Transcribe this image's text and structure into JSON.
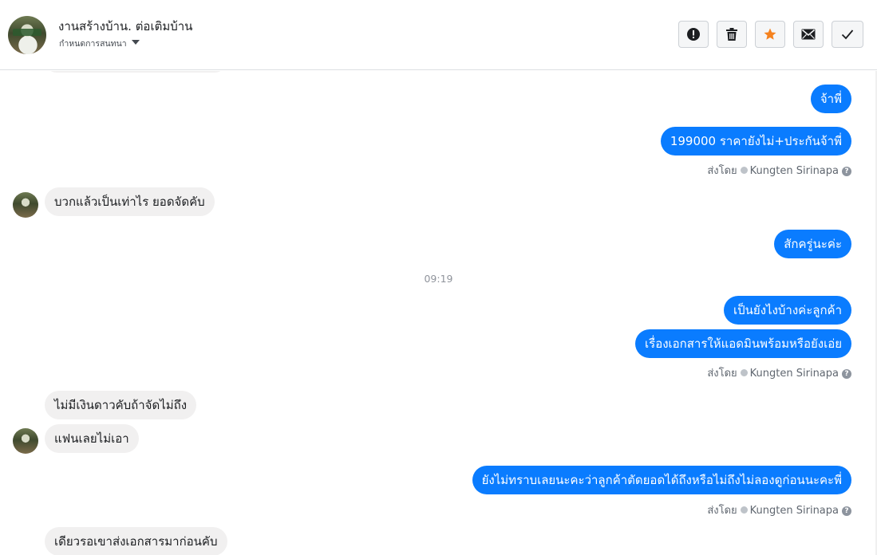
{
  "header": {
    "title": "งานสร้างบ้าน. ต่อเติมบ้าน",
    "subtitle": "กำหนดการสนทนา",
    "buttons": [
      {
        "name": "spam-button",
        "icon": "alert-icon"
      },
      {
        "name": "delete-button",
        "icon": "trash-icon"
      },
      {
        "name": "star-button",
        "icon": "star-icon",
        "color": "#f5821f"
      },
      {
        "name": "mark-unread-button",
        "icon": "envelope-icon"
      },
      {
        "name": "done-button",
        "icon": "check-icon"
      }
    ]
  },
  "messages": {
    "m0": "จ้าพี่",
    "m1": "199000  ราคายังไม่+ประกันจ้าพี่",
    "sent1": {
      "prefix": "ส่งโดย",
      "name": "Kungten Sirinapa"
    },
    "m2": "บวกแล้วเป็นเท่าไร  ยอดจัดคับ",
    "m3": "สักครู่นะค่ะ",
    "time": "09:19",
    "m4": "เป็นยังไงบ้างค่ะลูกค้า",
    "m5": "เรื่องเอกสารให้แอดมินพร้อมหรือยังเอ่ย",
    "sent2": {
      "prefix": "ส่งโดย",
      "name": "Kungten Sirinapa"
    },
    "m6": "ไม่มีเงินดาวคับถ้าจัดไม่ถึง",
    "m7": "แฟนเลยไม่เอา",
    "m8": "ยังไม่ทราบเลยนะคะว่าลูกค้าตัดยอดได้ถึงหรือไม่ถึงไม่ลองดูก่อนนะคะพี่",
    "sent3": {
      "prefix": "ส่งโดย",
      "name": "Kungten Sirinapa"
    },
    "m9": "เดียวรอเขาส่งเอกสารมาก่อนคับ"
  },
  "colors": {
    "outgoing": "#0a7cff",
    "incoming": "#f1f0f0",
    "star": "#f5821f"
  }
}
